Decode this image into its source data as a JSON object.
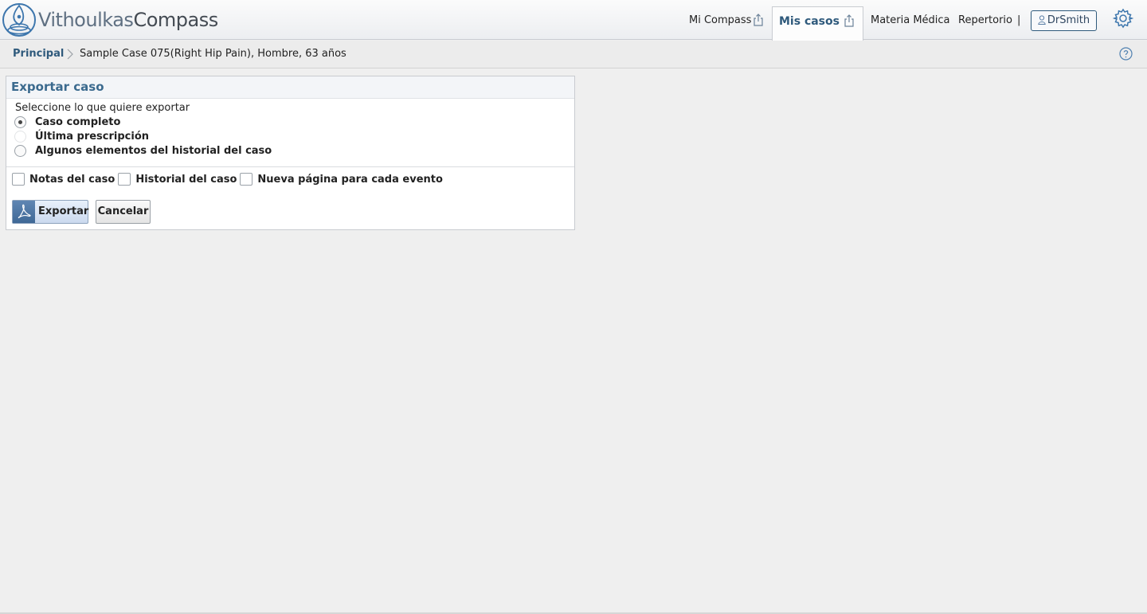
{
  "app": {
    "logo_part1": "Vithoulkas",
    "logo_part2": "Compass"
  },
  "nav": {
    "items": [
      {
        "label": "Mi Compass",
        "icon": "share-icon"
      },
      {
        "label": "Mis casos",
        "icon": "share-icon",
        "active": true
      },
      {
        "label": "Materia Médica"
      },
      {
        "label": "Repertorio"
      }
    ],
    "separator": "|",
    "user": "DrSmith"
  },
  "breadcrumb": {
    "home": "Principal",
    "current": "Sample Case 075(Right Hip Pain), Hombre, 63 años"
  },
  "export_panel": {
    "title": "Exportar caso",
    "prompt": "Seleccione lo que quiere exportar",
    "options": [
      {
        "label": "Caso completo",
        "checked": true,
        "enabled": true
      },
      {
        "label": "Última prescripción",
        "checked": false,
        "enabled": false
      },
      {
        "label": "Algunos elementos del historial del caso",
        "checked": false,
        "enabled": true
      }
    ],
    "checkboxes": [
      {
        "label": "Notas del caso",
        "checked": false
      },
      {
        "label": "Historial del caso",
        "checked": false
      },
      {
        "label": "Nueva página para cada evento",
        "checked": false
      }
    ],
    "export_label": "Exportar",
    "cancel_label": "Cancelar"
  },
  "colors": {
    "accent": "#2f5a7c",
    "panel_title": "#3b6a8e",
    "background": "#efefef"
  }
}
